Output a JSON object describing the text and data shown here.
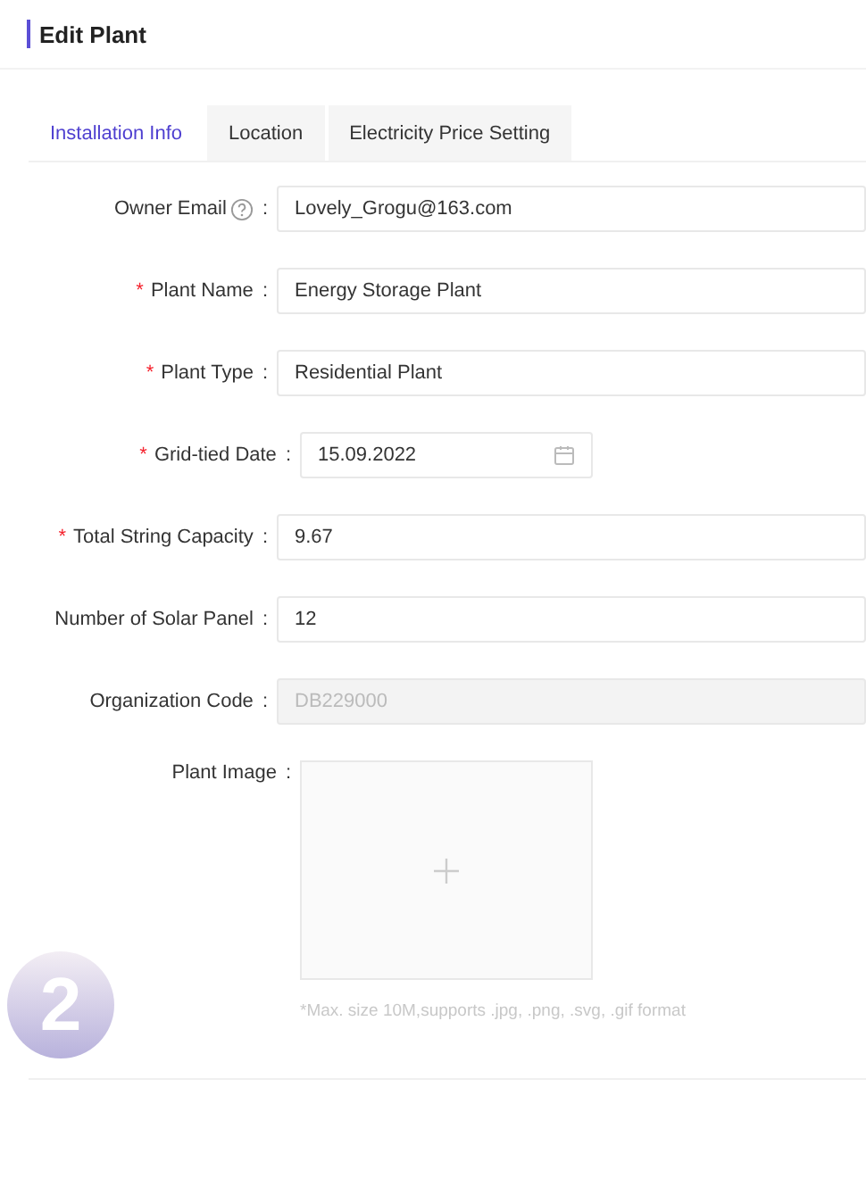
{
  "header": {
    "title": "Edit Plant"
  },
  "tabs": [
    {
      "label": "Installation Info",
      "selected": true
    },
    {
      "label": "Location",
      "selected": false
    },
    {
      "label": "Electricity Price Setting",
      "selected": false
    }
  ],
  "fields": [
    {
      "label": "Owner Email",
      "help": true,
      "colon": ":",
      "kind": "text",
      "value": "Lovely_Grogu@163.com"
    },
    {
      "mark": "*",
      "label": "Plant Name",
      "colon": ":",
      "kind": "text",
      "value": "Energy Storage Plant"
    },
    {
      "mark": "*",
      "label": "Plant Type",
      "colon": ":",
      "kind": "text",
      "value": "Residential Plant"
    },
    {
      "mark": "*",
      "label": "Grid-tied Date",
      "colon": ":",
      "kind": "date",
      "value": "15.09.2022"
    },
    {
      "mark": "*",
      "label": "Total String Capacity",
      "colon": ":",
      "kind": "text",
      "value": "9.67"
    },
    {
      "label": "Number of Solar Panel",
      "colon": ":",
      "kind": "text",
      "value": "12"
    },
    {
      "label": "Organization Code",
      "colon": ":",
      "kind": "text",
      "value": "DB229000",
      "disabled": true
    },
    {
      "label": "Plant Image",
      "colon": ":",
      "kind": "upload",
      "hint": "*Max. size 10M,supports .jpg, .png, .svg, .gif format"
    }
  ],
  "step_badge": "2"
}
